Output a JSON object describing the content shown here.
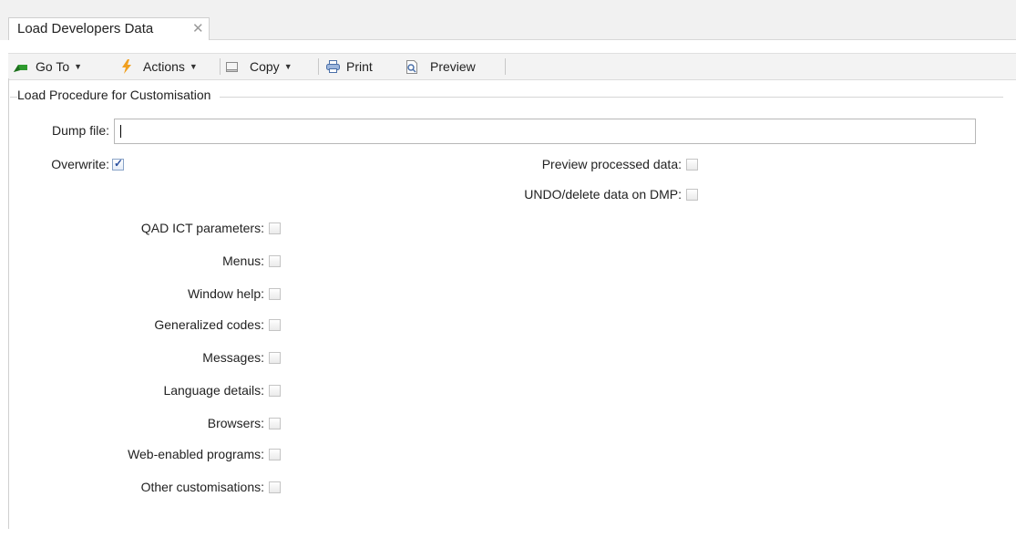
{
  "tab": {
    "title": "Load Developers Data",
    "close_glyph": "✕"
  },
  "toolbar": {
    "goto_label": "Go To",
    "actions_label": "Actions",
    "copy_label": "Copy",
    "print_label": "Print",
    "preview_label": "Preview",
    "icons": [
      "goto-arrow-icon",
      "actions-bolt-icon",
      "copy-icon",
      "print-icon",
      "preview-icon"
    ]
  },
  "group": {
    "title": "Load Procedure for Customisation"
  },
  "form": {
    "dump_file": {
      "label": "Dump file:",
      "value": ""
    },
    "overwrite": {
      "label": "Overwrite:",
      "checked": true
    },
    "preview_processed": {
      "label": "Preview processed data:",
      "checked": false
    },
    "undo_delete": {
      "label": "UNDO/delete data on DMP:",
      "checked": false
    },
    "options": [
      {
        "label": "QAD ICT parameters:",
        "checked": false
      },
      {
        "label": "Menus:",
        "checked": false
      },
      {
        "label": "Window help:",
        "checked": false
      },
      {
        "label": "Generalized codes:",
        "checked": false
      },
      {
        "label": "Messages:",
        "checked": false
      },
      {
        "label": "Language details:",
        "checked": false
      },
      {
        "label": "Browsers:",
        "checked": false
      },
      {
        "label": "Web-enabled programs:",
        "checked": false
      },
      {
        "label": "Other customisations:",
        "checked": false
      }
    ]
  },
  "colors": {
    "checkbox_tick": "#2a4f9e",
    "goto_green": "#2e9a2e",
    "actions_orange": "#f0a020"
  }
}
